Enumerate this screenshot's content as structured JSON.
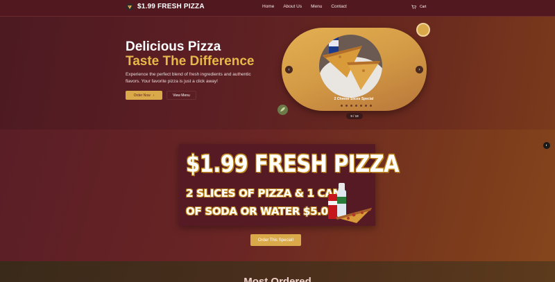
{
  "nav": {
    "brand": "$1.99 FRESH PIZZA",
    "links": [
      "Home",
      "About Us",
      "Menu",
      "Contact"
    ],
    "cart_label": "Cart"
  },
  "hero": {
    "title_line1": "Delicious Pizza",
    "title_line2": "Taste The Difference",
    "subtitle": "Experience the perfect blend of fresh ingredients and authentic flavors. Your favorite pizza is just a click away!",
    "order_button": "Order Now",
    "view_button": "View Menu"
  },
  "carousel": {
    "caption": "2 Cheese Slices Special",
    "counter": "9 / 18",
    "prev_icon": "chevron-left-icon",
    "next_icon": "chevron-right-icon"
  },
  "special": {
    "banner_title": "$1.99 FRESH PIZZA",
    "banner_line1": "2 SLICES OF PIZZA & 1 CAN",
    "banner_line2": "OF SODA OR WATER $5.00",
    "button": "Order This Special!"
  },
  "next_section": {
    "title": "Most Ordered"
  },
  "colors": {
    "accent": "#d9a94a",
    "background": "#5a1e26",
    "title_gold": "#e8b84a"
  }
}
